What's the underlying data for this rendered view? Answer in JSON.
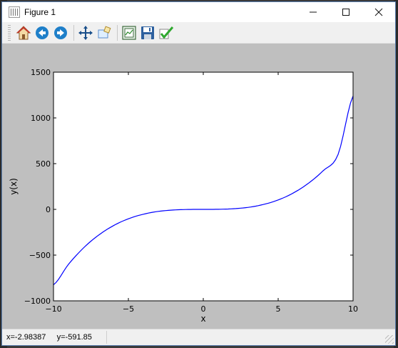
{
  "window": {
    "title": "Figure 1",
    "minimize_icon": "minimize-icon",
    "maximize_icon": "maximize-icon",
    "close_icon": "close-icon"
  },
  "toolbar": {
    "buttons": [
      {
        "name": "home",
        "icon": "home-icon"
      },
      {
        "name": "back",
        "icon": "back-arrow-icon"
      },
      {
        "name": "forward",
        "icon": "forward-arrow-icon"
      },
      {
        "name": "pan",
        "icon": "pan-move-icon"
      },
      {
        "name": "zoom",
        "icon": "zoom-rect-icon"
      },
      {
        "name": "subplots",
        "icon": "configure-subplots-icon"
      },
      {
        "name": "save",
        "icon": "save-floppy-icon"
      },
      {
        "name": "edit",
        "icon": "checkmark-edit-icon"
      }
    ],
    "colors": {
      "home_roof": "#c0392b",
      "nav_blue": "#1e7fc9",
      "save_blue": "#2c5f9e",
      "check_green": "#2fa82f"
    }
  },
  "status": {
    "coords": "x=-2.98387     y=-591.85"
  },
  "chart_data": {
    "type": "line",
    "function_shape": "cubic, y = 1.25·x³ (approx.)",
    "x": [
      -10,
      -9,
      -8,
      -7,
      -6,
      -5,
      -4,
      -3,
      -2,
      -1,
      0,
      1,
      2,
      3,
      4,
      5,
      6,
      7,
      8,
      9,
      10
    ],
    "series": [
      {
        "color": "#0000ff",
        "values": [
          -825,
          -601,
          -422,
          -283,
          -178,
          -103,
          -53,
          -22,
          -7,
          -1,
          0,
          1,
          7,
          22,
          53,
          103,
          178,
          283,
          422,
          601,
          1240
        ]
      }
    ],
    "title": "",
    "xlabel": "x",
    "ylabel": "y(x)",
    "xlim": [
      -10,
      10
    ],
    "ylim": [
      -1000,
      1500
    ],
    "xticks": [
      "−10",
      "−5",
      "0",
      "5",
      "10"
    ],
    "xtick_values": [
      -10,
      -5,
      0,
      5,
      10
    ],
    "yticks": [
      "−1000",
      "−500",
      "0",
      "500",
      "1000",
      "1500"
    ],
    "ytick_values": [
      -1000,
      -500,
      0,
      500,
      1000,
      1500
    ],
    "grid": false,
    "legend": "none",
    "canvas_background": "#bfbfbf",
    "axes_background": "#ffffff"
  }
}
